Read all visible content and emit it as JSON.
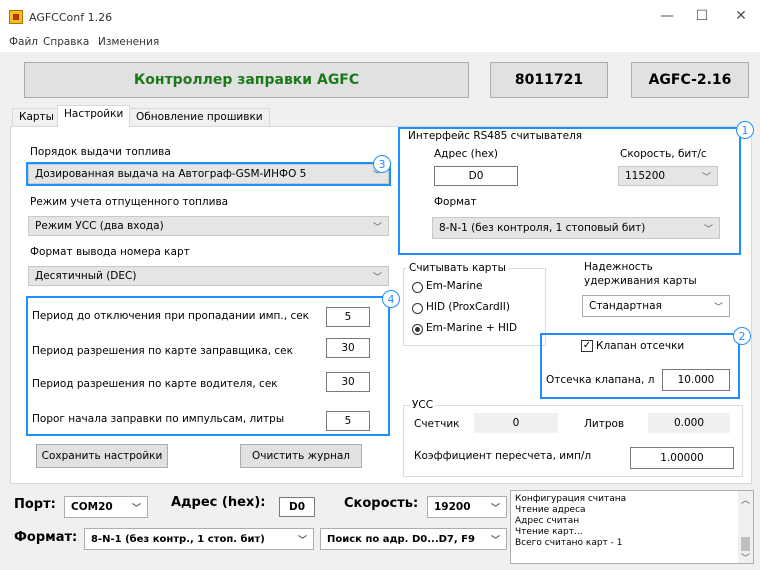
{
  "window": {
    "title": "AGFCConf 1.26",
    "minimize": "—",
    "maximize": "☐",
    "close": "✕"
  },
  "menu": [
    "Файл",
    "Справка",
    "Изменения"
  ],
  "header": {
    "controller": "Контроллер заправки AGFC",
    "serial": "8011721",
    "model": "AGFC-2.16",
    "controller_color": "#1a7a1a"
  },
  "tabs": [
    "Карты",
    "Настройки",
    "Обновление прошивки"
  ],
  "settings": {
    "fuel_order_label": "Порядок выдачи топлива",
    "fuel_order_value": "Дозированная выдача на Автограф-GSM-ИНФО 5",
    "fuel_mode_label": "Режим учета отпущенного топлива",
    "fuel_mode_value": "Режим УСС (два входа)",
    "card_format_label": "Формат вывода номера карт",
    "card_format_value": "Десятичный (DEC)",
    "periods": [
      {
        "label": "Период до отключения при пропадании имп., сек",
        "value": "5"
      },
      {
        "label": "Период разрешения по карте заправщика, сек",
        "value": "30"
      },
      {
        "label": "Период разрешения по карте водителя, сек",
        "value": "30"
      },
      {
        "label": "Порог начала заправки по импульсам, литры",
        "value": "5"
      }
    ],
    "save_button": "Сохранить настройки",
    "clear_button": "Очистить журнал"
  },
  "rs485": {
    "title": "Интерфейс RS485 считывателя",
    "address_label": "Адрес (hex)",
    "address_value": "D0",
    "speed_label": "Скорость, бит/с",
    "speed_value": "115200",
    "format_label": "Формат",
    "format_value": "8-N-1 (без контроля, 1 стоповый бит)"
  },
  "read_cards": {
    "title": "Считывать карты",
    "options": [
      "Em-Marine",
      "HID (ProxCardII)",
      "Em-Marine + HID"
    ],
    "selected": 2
  },
  "reliability": {
    "label": "Надежность удерживания карты",
    "line1": "Надежность",
    "line2": "удерживания карты",
    "value": "Стандартная"
  },
  "valve": {
    "checkbox": "Клапан отсечки",
    "checked": true,
    "cutoff_label": "Отсечка клапана, л",
    "cutoff_value": "10.000"
  },
  "uss": {
    "title": "УСС",
    "counter_label": "Счетчик",
    "counter_value": "0",
    "liters_label": "Литров",
    "liters_value": "0.000",
    "coef_label": "Коэффициент пересчета, имп/л",
    "coef_value": "1.00000"
  },
  "badges": [
    "1",
    "2",
    "3",
    "4"
  ],
  "bottom": {
    "port_label": "Порт:",
    "port_value": "COM20",
    "address_label": "Адрес (hex):",
    "address_value": "D0",
    "speed_label": "Скорость:",
    "speed_value": "19200",
    "format_label": "Формат:",
    "format_value": "8-N-1 (без контр., 1 стоп. бит)",
    "search_value": "Поиск по адр. D0...D7, F9"
  },
  "log": [
    "Конфигурация считана",
    "Чтение адреса",
    "Адрес считан",
    "Чтение карт...",
    "Всего считано карт - 1"
  ],
  "colors": {
    "highlight": "#1e90ff"
  }
}
